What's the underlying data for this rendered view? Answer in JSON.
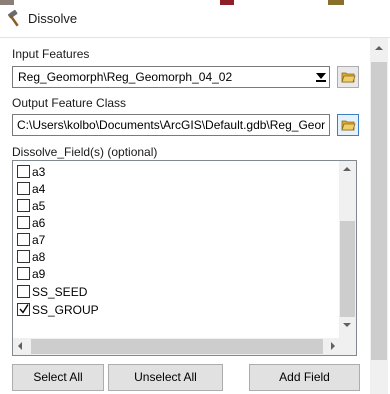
{
  "window": {
    "title": "Dissolve"
  },
  "input_features": {
    "label": "Input Features",
    "value": "Reg_Geomorph\\Reg_Geomorph_04_02"
  },
  "output_feature_class": {
    "label": "Output Feature Class",
    "value": "C:\\Users\\kolbo\\Documents\\ArcGIS\\Default.gdb\\Reg_Geor"
  },
  "dissolve_fields": {
    "label": "Dissolve_Field(s) (optional)",
    "items": [
      {
        "label": "a3",
        "checked": false
      },
      {
        "label": "a4",
        "checked": false
      },
      {
        "label": "a5",
        "checked": false
      },
      {
        "label": "a6",
        "checked": false
      },
      {
        "label": "a7",
        "checked": false
      },
      {
        "label": "a8",
        "checked": false
      },
      {
        "label": "a9",
        "checked": false
      },
      {
        "label": "SS_SEED",
        "checked": false
      },
      {
        "label": "SS_GROUP",
        "checked": true
      }
    ]
  },
  "buttons": {
    "select_all": "Select All",
    "unselect_all": "Unselect All",
    "add_field": "Add Field"
  },
  "icons": {
    "title": "hammer-icon",
    "browse": "folder-open-icon"
  }
}
